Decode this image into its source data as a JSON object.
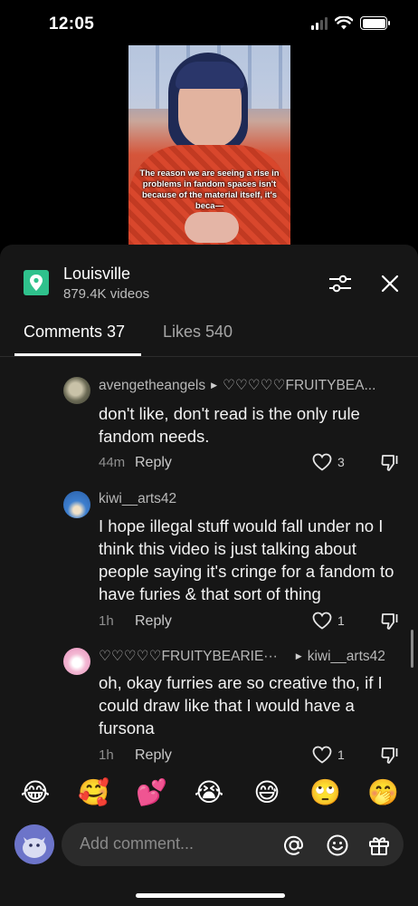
{
  "status_bar": {
    "time": "12:05"
  },
  "video": {
    "caption": "The reason we are seeing a rise in problems in fandom spaces isn't because of the material itself, it's beca—"
  },
  "place": {
    "title": "Louisville",
    "subtitle": "879.4K videos"
  },
  "tabs": [
    {
      "label": "Comments 37",
      "active": true
    },
    {
      "label": "Likes 540",
      "active": false
    }
  ],
  "comments": [
    {
      "username": "avengetheangels",
      "reply_to": "♡♡♡♡♡FRUITYBEA...",
      "text": "don't like, don't read is the only rule fandom needs.",
      "time": "44m",
      "reply_label": "Reply",
      "likes": "3"
    },
    {
      "username": "kiwi__arts42",
      "reply_to": "",
      "text": "I hope illegal stuff would fall under no I think this video is just talking about people saying it's cringe for a fandom to have furies & that sort of thing",
      "time": "1h",
      "reply_label": "Reply",
      "likes": "1"
    },
    {
      "username": "♡♡♡♡♡FRUITYBEARIE···",
      "reply_to": "kiwi__arts42",
      "text": "oh, okay furries are so creative tho, if I could draw like that I would have a fursona",
      "time": "1h",
      "reply_label": "Reply",
      "likes": "1"
    }
  ],
  "emojis": [
    "😂",
    "🥰",
    "💕",
    "😭",
    "😅",
    "🙄",
    "🤭"
  ],
  "input": {
    "placeholder": "Add comment..."
  },
  "colors": {
    "place_icon": "#2fc18c",
    "sheet_bg": "#161616",
    "input_bg": "#2b2b2b"
  },
  "icons": [
    "location-pin-icon",
    "filter-icon",
    "close-icon",
    "heart-icon",
    "dislike-icon",
    "at-icon",
    "emoji-icon",
    "gift-icon"
  ]
}
